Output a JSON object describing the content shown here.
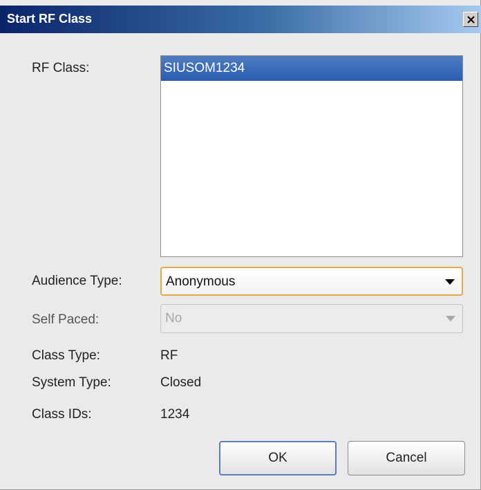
{
  "window": {
    "title": "Start RF Class"
  },
  "form": {
    "rf_class": {
      "label": "RF Class:",
      "items": [
        "SIUSOM1234"
      ]
    },
    "audience_type": {
      "label": "Audience Type:",
      "value": "Anonymous"
    },
    "self_paced": {
      "label": "Self Paced:",
      "value": "No"
    },
    "class_type": {
      "label": "Class Type:",
      "value": "RF"
    },
    "system_type": {
      "label": "System Type:",
      "value": "Closed"
    },
    "class_ids": {
      "label": "Class IDs:",
      "value": "1234"
    }
  },
  "buttons": {
    "ok": "OK",
    "cancel": "Cancel"
  },
  "colors": {
    "titlebar_start": "#0a246a",
    "titlebar_end": "#a6caf0",
    "selection": "#2a5db0",
    "focus_border": "#e6a64a"
  },
  "icons": {
    "close": "close-icon",
    "dropdown": "chevron-down-icon"
  }
}
